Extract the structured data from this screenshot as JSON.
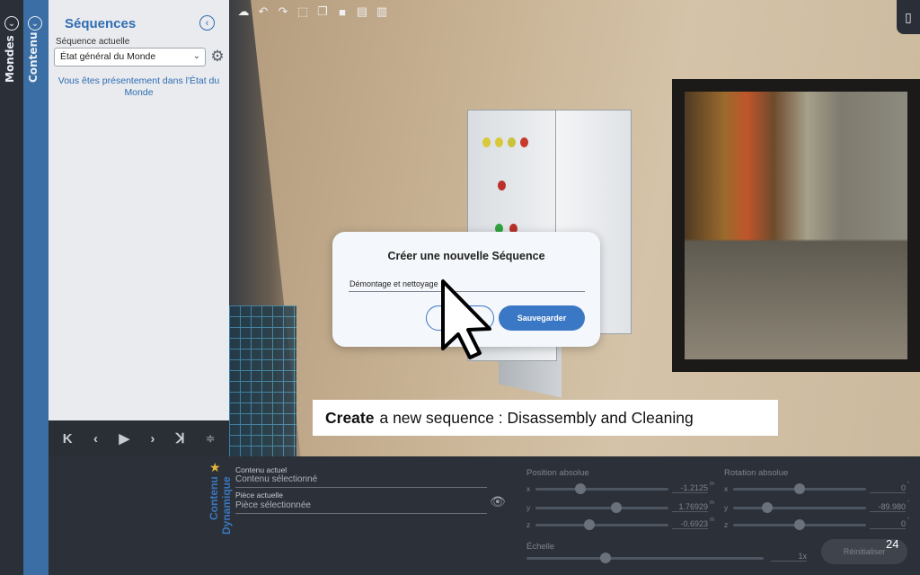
{
  "rails": {
    "mondes_label": "Mondes",
    "contenu_label": "Contenu",
    "dynamic_label": "Contenu Dynamique"
  },
  "sequences": {
    "title": "Séquences",
    "current_label": "Séquence actuelle",
    "current_value": "État général du Monde",
    "info": "Vous êtes présentement dans l'État du Monde"
  },
  "playback": {
    "buttons": [
      "first",
      "previous",
      "play",
      "next",
      "last",
      "settings"
    ]
  },
  "content": {
    "current_content_label": "Contenu actuel",
    "current_content_value": "Contenu sélectionné",
    "current_piece_label": "Pièce actuelle",
    "current_piece_value": "Pièce sélectionnée"
  },
  "transform": {
    "position_title": "Position absolue",
    "rotation_title": "Rotation absolue",
    "scale_title": "Échelle",
    "position": {
      "x": "-1.2125",
      "y": "1.76929",
      "z": "-0.6923",
      "unit": "m"
    },
    "rotation": {
      "x": "0",
      "y": "-89.980",
      "z": "0",
      "unit": "°"
    },
    "scale": "1x",
    "reset_label": "Réinitialiser"
  },
  "dialog": {
    "title": "Créer une nouvelle Séquence",
    "input_value": "Démontage et nettoyage",
    "cancel_label": "",
    "save_label": "Sauvegarder"
  },
  "caption": {
    "bold": "Create",
    "rest": "a new sequence : Disassembly and Cleaning"
  },
  "slide_number": "24",
  "colors": {
    "accent": "#3a78c5",
    "panel_bg": "#e9ebee",
    "rail_blue": "#3a6ea5",
    "dark": "#2c3038"
  }
}
